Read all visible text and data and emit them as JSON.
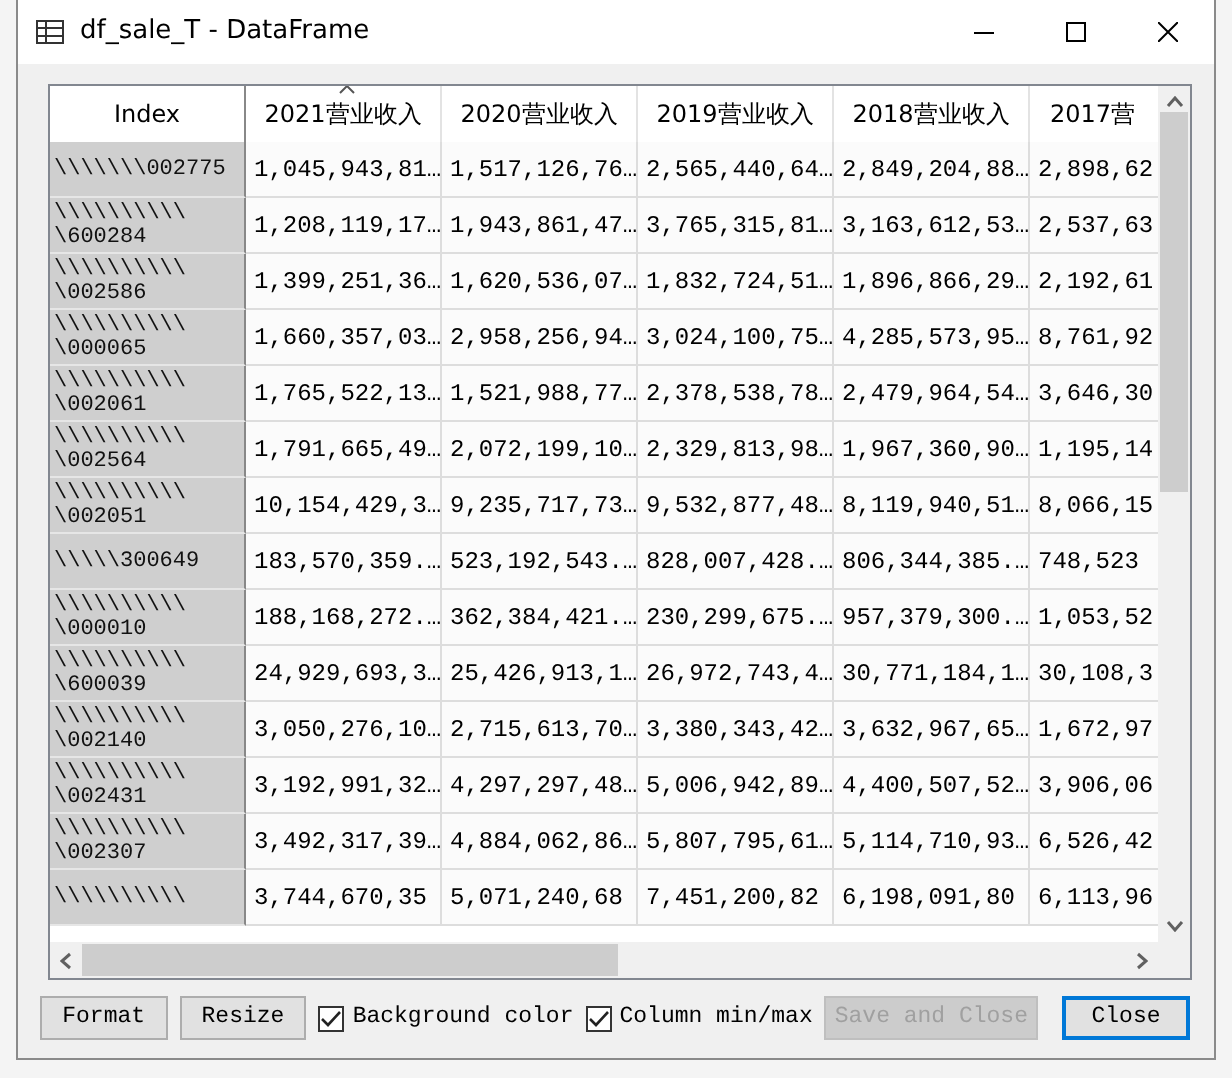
{
  "window": {
    "title": "df_sale_T - DataFrame"
  },
  "table": {
    "index_header": "Index",
    "columns": [
      {
        "label": "2021营业收入",
        "sorted": true
      },
      {
        "label": "2020营业收入",
        "sorted": false
      },
      {
        "label": "2019营业收入",
        "sorted": false
      },
      {
        "label": "2018营业收入",
        "sorted": false
      },
      {
        "label": "2017营",
        "sorted": false
      }
    ],
    "rows": [
      {
        "index": [
          "\\\\\\\\\\\\\\002775"
        ],
        "cells": [
          "1,045,943,81…",
          "1,517,126,76…",
          "2,565,440,64…",
          "2,849,204,88…",
          "2,898,62"
        ]
      },
      {
        "index": [
          "\\\\\\\\\\\\\\\\\\\\",
          "\\600284"
        ],
        "cells": [
          "1,208,119,17…",
          "1,943,861,47…",
          "3,765,315,81…",
          "3,163,612,53…",
          "2,537,63"
        ]
      },
      {
        "index": [
          "\\\\\\\\\\\\\\\\\\\\",
          "\\002586"
        ],
        "cells": [
          "1,399,251,36…",
          "1,620,536,07…",
          "1,832,724,51…",
          "1,896,866,29…",
          "2,192,61"
        ]
      },
      {
        "index": [
          "\\\\\\\\\\\\\\\\\\\\",
          "\\000065"
        ],
        "cells": [
          "1,660,357,03…",
          "2,958,256,94…",
          "3,024,100,75…",
          "4,285,573,95…",
          "8,761,92"
        ]
      },
      {
        "index": [
          "\\\\\\\\\\\\\\\\\\\\",
          "\\002061"
        ],
        "cells": [
          "1,765,522,13…",
          "1,521,988,77…",
          "2,378,538,78…",
          "2,479,964,54…",
          "3,646,30"
        ]
      },
      {
        "index": [
          "\\\\\\\\\\\\\\\\\\\\",
          "\\002564"
        ],
        "cells": [
          "1,791,665,49…",
          "2,072,199,10…",
          "2,329,813,98…",
          "1,967,360,90…",
          "1,195,14"
        ]
      },
      {
        "index": [
          "\\\\\\\\\\\\\\\\\\\\",
          "\\002051"
        ],
        "cells": [
          "10,154,429,3…",
          "9,235,717,73…",
          "9,532,877,48…",
          "8,119,940,51…",
          "8,066,15"
        ]
      },
      {
        "index": [
          "\\\\\\\\\\300649"
        ],
        "cells": [
          "183,570,359.…",
          "523,192,543.…",
          "828,007,428.…",
          "806,344,385.…",
          "748,523"
        ]
      },
      {
        "index": [
          "\\\\\\\\\\\\\\\\\\\\",
          "\\000010"
        ],
        "cells": [
          "188,168,272.…",
          "362,384,421.…",
          "230,299,675.…",
          "957,379,300.…",
          "1,053,52"
        ]
      },
      {
        "index": [
          "\\\\\\\\\\\\\\\\\\\\",
          "\\600039"
        ],
        "cells": [
          "24,929,693,3…",
          "25,426,913,1…",
          "26,972,743,4…",
          "30,771,184,1…",
          "30,108,3"
        ]
      },
      {
        "index": [
          "\\\\\\\\\\\\\\\\\\\\",
          "\\002140"
        ],
        "cells": [
          "3,050,276,10…",
          "2,715,613,70…",
          "3,380,343,42…",
          "3,632,967,65…",
          "1,672,97"
        ]
      },
      {
        "index": [
          "\\\\\\\\\\\\\\\\\\\\",
          "\\002431"
        ],
        "cells": [
          "3,192,991,32…",
          "4,297,297,48…",
          "5,006,942,89…",
          "4,400,507,52…",
          "3,906,06"
        ]
      },
      {
        "index": [
          "\\\\\\\\\\\\\\\\\\\\",
          "\\002307"
        ],
        "cells": [
          "3,492,317,39…",
          "4,884,062,86…",
          "5,807,795,61…",
          "5,114,710,93…",
          "6,526,42"
        ]
      },
      {
        "index": [
          "\\\\\\\\\\\\\\\\\\\\"
        ],
        "cells": [
          "3,744,670,35",
          "5,071,240,68",
          "7,451,200,82",
          "6,198,091,80",
          "6,113,96"
        ]
      }
    ]
  },
  "controls": [
    {
      "kind": "button",
      "label": "Format",
      "disabled": false,
      "focused": false
    },
    {
      "kind": "button",
      "label": "Resize",
      "disabled": false,
      "focused": false
    },
    {
      "kind": "checkbox",
      "label": "Background color",
      "checked": true
    },
    {
      "kind": "checkbox",
      "label": "Column min/max",
      "checked": true
    },
    {
      "kind": "button",
      "label": "Save and Close",
      "disabled": true,
      "focused": false
    },
    {
      "kind": "button",
      "label": "Close",
      "disabled": false,
      "focused": true
    }
  ]
}
